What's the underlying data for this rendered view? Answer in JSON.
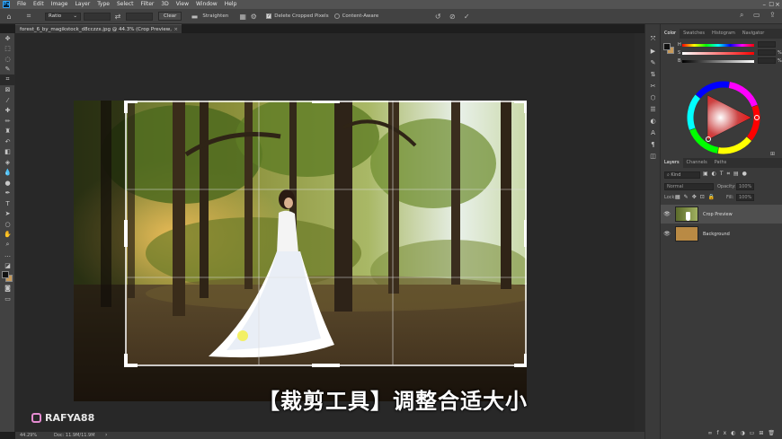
{
  "menu": [
    "File",
    "Edit",
    "Image",
    "Layer",
    "Type",
    "Select",
    "Filter",
    "3D",
    "View",
    "Window",
    "Help"
  ],
  "options_bar": {
    "ratio_label": "Ratio",
    "clear_label": "Clear",
    "straighten_label": "Straighten",
    "delete_cropped_label": "Delete Cropped Pixels",
    "content_aware_label": "Content-Aware"
  },
  "document_tab": {
    "title": "forest_6_by_magikstock_d8cczzx.jpg @ 44.3% (Crop Preview, RGB/8*) *"
  },
  "status_bar": {
    "zoom": "44.29%",
    "doc_info": "Doc: 11.9M/11.9M"
  },
  "color_panel": {
    "tabs": [
      "Color",
      "Swatches",
      "Histogram",
      "Navigator"
    ],
    "sliders": [
      {
        "label": "H",
        "unit": ""
      },
      {
        "label": "S",
        "unit": "%"
      },
      {
        "label": "B",
        "unit": "%"
      }
    ]
  },
  "layers_panel": {
    "tabs": [
      "Layers",
      "Channels",
      "Paths"
    ],
    "kind_label": "Kind",
    "blend_mode": "Normal",
    "opacity_label": "Opacity:",
    "opacity_value": "100%",
    "lock_label": "Lock:",
    "fill_label": "Fill:",
    "fill_value": "100%",
    "layers": [
      {
        "name": "Crop Preview"
      },
      {
        "name": "Background"
      }
    ]
  },
  "watermark": "RAFYA88",
  "subtitle": "【裁剪工具】调整合适大小"
}
